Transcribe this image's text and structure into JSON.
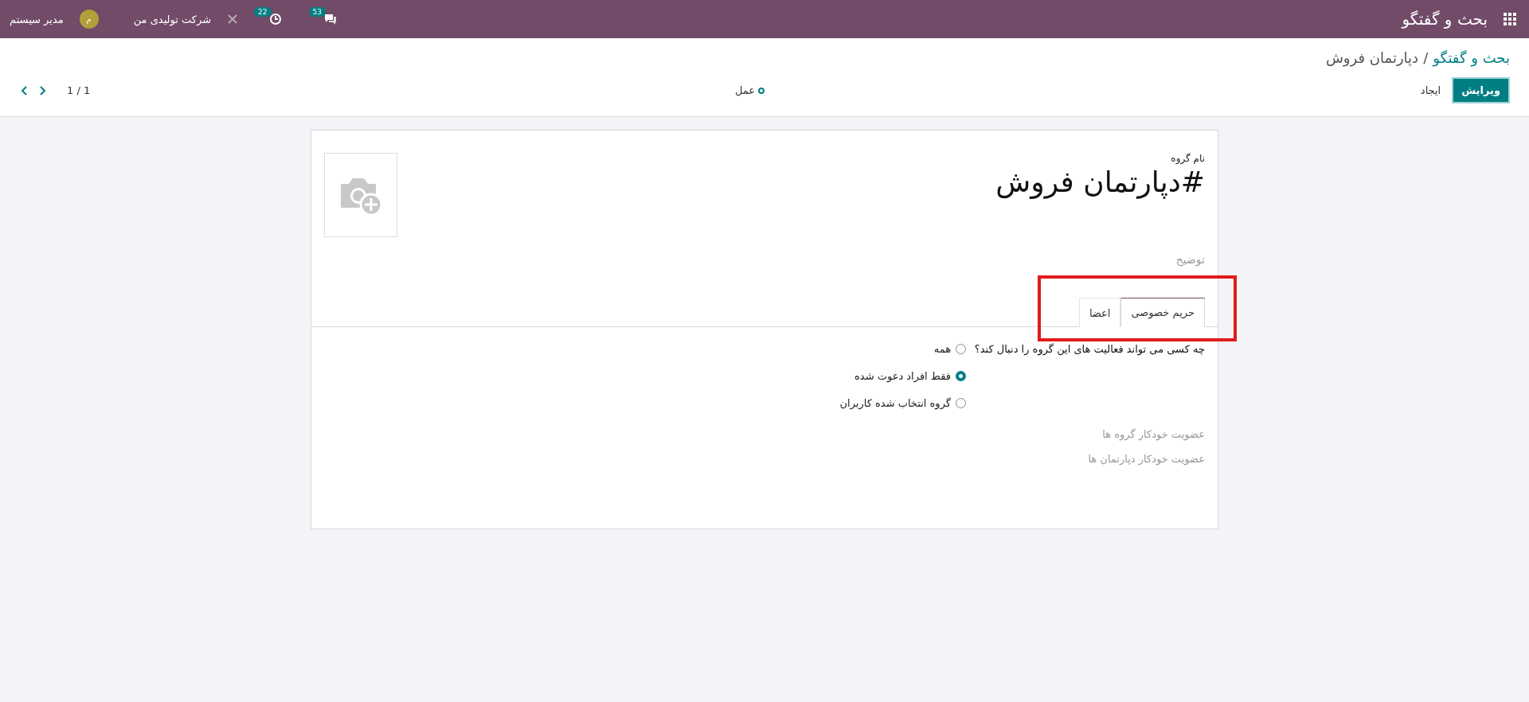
{
  "app_bar": {
    "title": "بحث و گفتگو",
    "message_count": "53",
    "activity_count": "22",
    "company": "شرکت تولیدی من",
    "user": {
      "initial": "م",
      "name": "مدیر سیستم"
    }
  },
  "breadcrumb": [
    {
      "label": "بحث و گفتگو",
      "link": true
    },
    {
      "label": "/",
      "link": false
    },
    {
      "label": "دپارتمان فروش",
      "link": false
    }
  ],
  "buttons": [
    {
      "label": "ویرایش",
      "primary": true
    },
    {
      "label": "ایجاد",
      "primary": false
    }
  ],
  "action": "عمل",
  "pager": "1 / 1",
  "form": {
    "name_label": "نام گروه",
    "name": "#دپارتمان فروش",
    "description_placeholder": "توضیح",
    "tabs": [
      {
        "label": "حریم خصوصی",
        "selected": true
      },
      {
        "label": "اعضا",
        "selected": false
      }
    ],
    "tabs_highlighted": true,
    "privacy_question": "چه کسی می تواند فعالیت های این گروه را دنبال کند؟",
    "options": [
      {
        "label": "همه",
        "selected": false
      },
      {
        "label": "فقط افراد دعوت شده",
        "selected": true
      },
      {
        "label": "گروه انتخاب شده کاربران",
        "selected": false
      }
    ],
    "fields": [
      "عضویت خودکار گروه ها",
      "عضویت خودکار دپارتمان ها"
    ]
  }
}
